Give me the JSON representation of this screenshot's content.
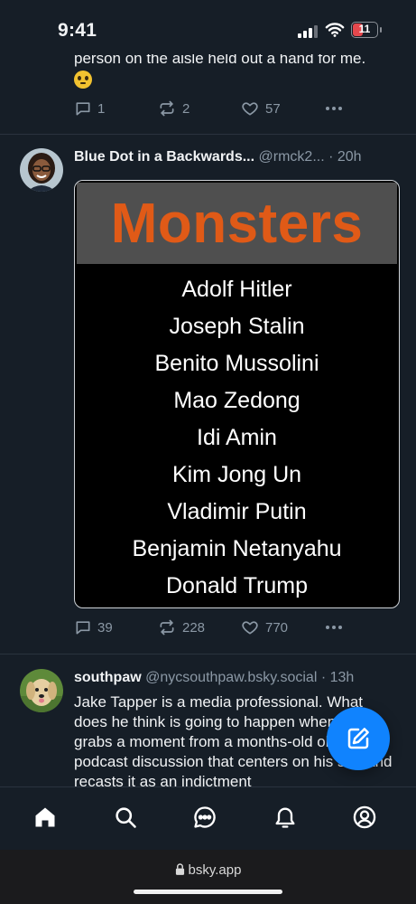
{
  "status_bar": {
    "time": "9:41",
    "battery": "11"
  },
  "posts": [
    {
      "text": "person on the aisle held out a hand for me.",
      "replies": "1",
      "reposts": "2",
      "likes": "57"
    },
    {
      "author": "Blue Dot in a Backwards...",
      "handle": "@rmck2...",
      "time_ago": "· 20h",
      "embed": {
        "title": "Monsters",
        "items": [
          "Adolf Hitler",
          "Joseph Stalin",
          "Benito Mussolini",
          "Mao Zedong",
          "Idi Amin",
          "Kim Jong Un",
          "Vladimir Putin",
          "Benjamin Netanyahu",
          "Donald Trump"
        ]
      },
      "replies": "39",
      "reposts": "228",
      "likes": "770"
    },
    {
      "author": "southpaw",
      "handle": "@nycsouthpaw.bsky.social",
      "time_ago": "· 13h",
      "text": "Jake Tapper is a media professional. What does he think is going to happen when he grabs a moment from a months-old obscure podcast discussion that centers on his son and recasts it as an indictment"
    }
  ],
  "nav": {
    "items": [
      "home-icon",
      "search-icon",
      "chat-icon",
      "notifications-icon",
      "profile-icon"
    ]
  },
  "browser": {
    "url": "bsky.app"
  },
  "colors": {
    "accent": "#1083fe",
    "background": "#161e27",
    "muted": "#8b98a5",
    "monster_title": "#e05a17"
  }
}
